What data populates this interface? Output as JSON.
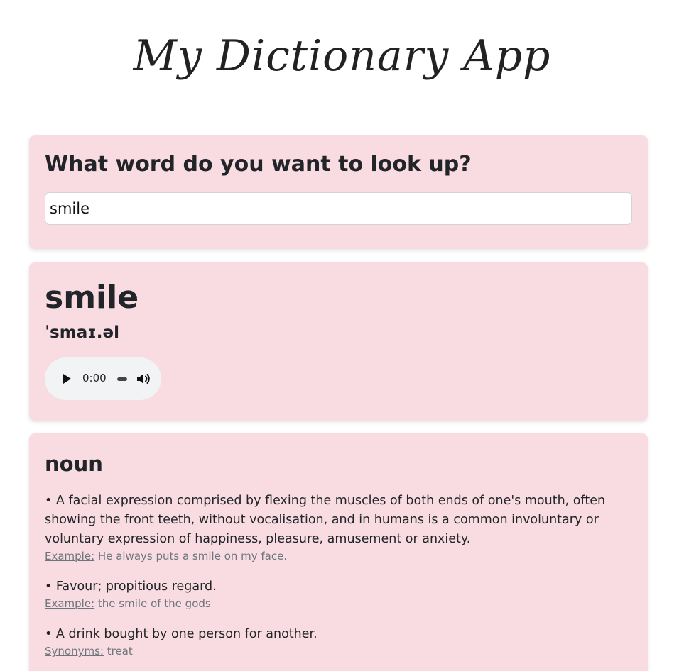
{
  "header": {
    "title": "My Dictionary App"
  },
  "search": {
    "heading": "What word do you want to look up?",
    "value": "smile"
  },
  "result": {
    "word": "smile",
    "phonetic": "ˈsmaɪ.əl",
    "audio": {
      "time": "0:00"
    }
  },
  "meaning": {
    "part_of_speech": "noun",
    "bullet": "•",
    "definitions": [
      {
        "text": "A facial expression comprised by flexing the muscles of both ends of one's mouth, often showing the front teeth, without vocalisation, and in humans is a common involuntary or voluntary expression of happiness, pleasure, amusement or anxiety.",
        "detail_label": "Example:",
        "detail_value": "He always puts a smile on my face."
      },
      {
        "text": "Favour; propitious regard.",
        "detail_label": "Example:",
        "detail_value": "the smile of the gods"
      },
      {
        "text": "A drink bought by one person for another.",
        "detail_label": "Synonyms:",
        "detail_value": "treat"
      }
    ]
  },
  "colors": {
    "card_background": "#f9dce1",
    "text": "#212529",
    "muted_text": "#6c757d"
  }
}
